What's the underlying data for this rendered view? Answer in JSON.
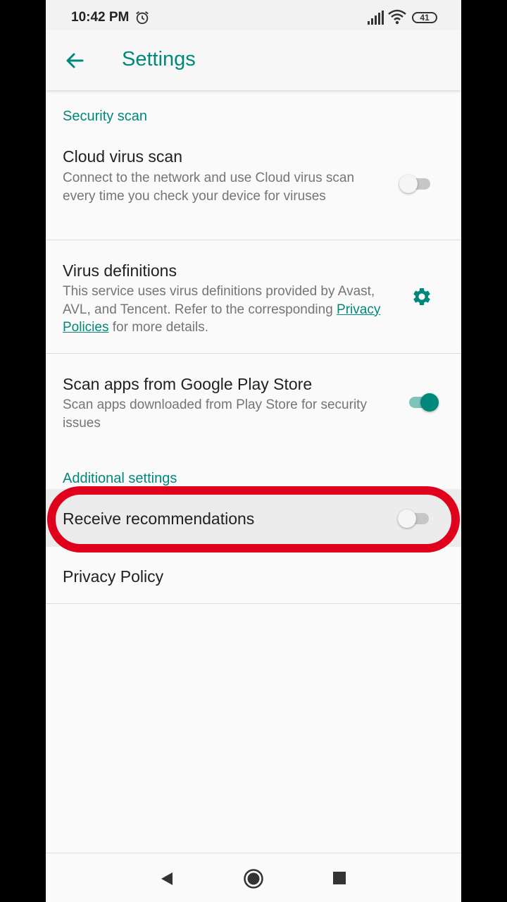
{
  "status_bar": {
    "time": "10:42 PM",
    "battery": "41"
  },
  "app_bar": {
    "title": "Settings"
  },
  "sections": {
    "security_scan": "Security scan",
    "additional_settings": "Additional settings"
  },
  "rows": {
    "cloud_scan": {
      "title": "Cloud virus scan",
      "subtitle": "Connect to the network and use Cloud virus scan every time you check your device for viruses",
      "enabled": false
    },
    "virus_definitions": {
      "title": "Virus definitions",
      "subtitle_before": "This service uses virus definitions provided by Avast, AVL, and Tencent. Refer to the corresponding ",
      "link": "Privacy Policies",
      "subtitle_after": " for more details."
    },
    "play_store_scan": {
      "title": "Scan apps from Google Play Store",
      "subtitle": "Scan apps downloaded from Play Store for security issues",
      "enabled": true
    },
    "recommendations": {
      "title": "Receive recommendations",
      "enabled": false
    },
    "privacy_policy": {
      "title": "Privacy Policy"
    }
  },
  "colors": {
    "accent": "#00897b",
    "highlight": "#e0001b"
  }
}
